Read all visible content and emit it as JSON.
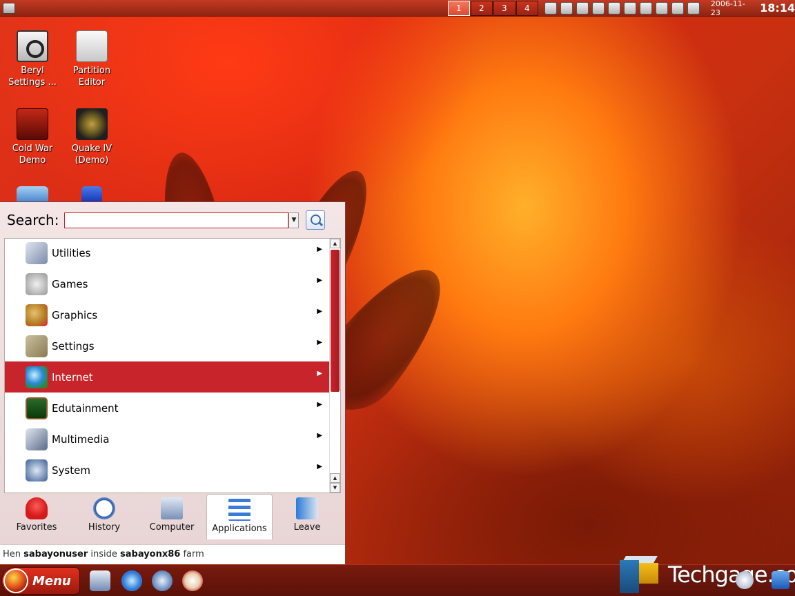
{
  "top_panel": {
    "desktops": [
      "1",
      "2",
      "3",
      "4"
    ],
    "active_desktop": "1",
    "date": "2006-11-23",
    "time": "18:14"
  },
  "desktop_icons": [
    {
      "label": "Beryl Settings ...",
      "icon": "wrench-settings-icon"
    },
    {
      "label": "Partition Editor",
      "icon": "hard-drive-icon"
    },
    {
      "label": "Cold War Demo",
      "icon": "cold-war-game-icon"
    },
    {
      "label": "Quake IV (Demo)",
      "icon": "quake-icon"
    }
  ],
  "menu": {
    "search": {
      "label": "Search:",
      "value": ""
    },
    "categories": [
      {
        "label": "Utilities",
        "icon": "utilities-icon"
      },
      {
        "label": "Games",
        "icon": "gamepad-icon"
      },
      {
        "label": "Graphics",
        "icon": "palette-icon"
      },
      {
        "label": "Settings",
        "icon": "tools-icon"
      },
      {
        "label": "Internet",
        "icon": "globe-icon"
      },
      {
        "label": "Edutainment",
        "icon": "chalkboard-icon"
      },
      {
        "label": "Multimedia",
        "icon": "speaker-icon"
      },
      {
        "label": "System",
        "icon": "gears-icon"
      }
    ],
    "highlighted_category": "Internet",
    "tabs": [
      {
        "label": "Favorites",
        "icon": "heart-icon"
      },
      {
        "label": "History",
        "icon": "clock-icon"
      },
      {
        "label": "Computer",
        "icon": "computer-icon"
      },
      {
        "label": "Applications",
        "icon": "applications-list-icon"
      },
      {
        "label": "Leave",
        "icon": "exit-door-icon"
      }
    ],
    "active_tab": "Applications",
    "status": {
      "prefix": "Hen",
      "user": "sabayonuser",
      "middle": "inside",
      "host": "sabayonx86",
      "suffix": "farm"
    }
  },
  "bottom_panel": {
    "menu_label": "Menu",
    "watermark": "Techgage.com"
  },
  "colors": {
    "accent": "#c8242c",
    "panel": "#8e2412"
  }
}
